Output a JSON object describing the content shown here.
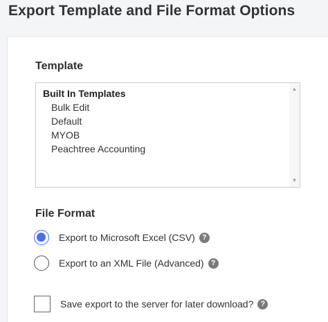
{
  "page": {
    "title": "Export Template and File Format Options"
  },
  "template_section": {
    "heading": "Template",
    "list": {
      "group_label": "Built In Templates",
      "options": [
        "Bulk Edit",
        "Default",
        "MYOB",
        "Peachtree Accounting"
      ],
      "scroll_up_icon": "scroll-up-arrow",
      "scroll_down_icon": "scroll-down-arrow"
    }
  },
  "file_format_section": {
    "heading": "File Format",
    "options": [
      {
        "label": "Export to Microsoft Excel (CSV)",
        "selected": true,
        "help_icon": "?"
      },
      {
        "label": "Export to an XML File (Advanced)",
        "selected": false,
        "help_icon": "?"
      }
    ]
  },
  "save_option": {
    "label": "Save export to the server for later download?",
    "checked": false,
    "help_icon": "?"
  },
  "colors": {
    "accent": "#4a6cf7",
    "help_icon_bg": "#7a7a7a",
    "page_bg": "#f4f5f7"
  }
}
